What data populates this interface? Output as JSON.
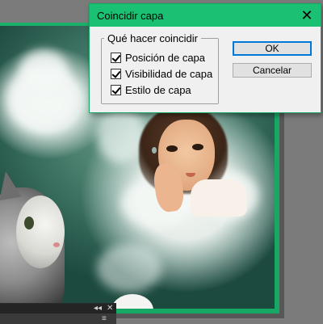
{
  "dialog": {
    "title": "Coincidir capa",
    "close_glyph": "✕",
    "group_label": "Qué hacer coincidir",
    "options": [
      {
        "label": "Posición de capa",
        "checked": true
      },
      {
        "label": "Visibilidad de capa",
        "checked": true
      },
      {
        "label": "Estilo de capa",
        "checked": true
      }
    ],
    "ok_label": "OK",
    "cancel_label": "Cancelar",
    "accent_color": "#1bc173"
  },
  "panel": {
    "collapse_glyph": "◂◂",
    "close_glyph": "✕",
    "menu_glyph": "≡"
  },
  "icons": {
    "close": "close-icon",
    "checkbox": "checkmark-icon",
    "panel_collapse": "double-chevron-left-icon",
    "panel_menu": "panel-menu-icon"
  }
}
